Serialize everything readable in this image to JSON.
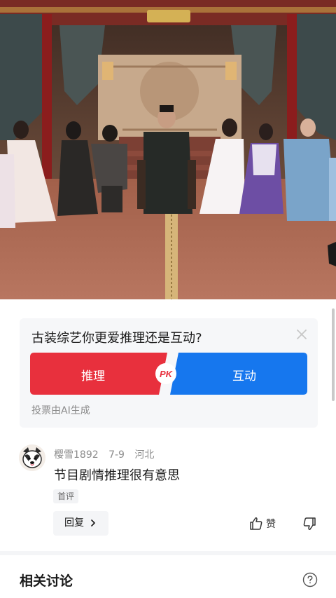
{
  "poll": {
    "question": "古装综艺你更爱推理还是互动?",
    "option_left": "推理",
    "option_right": "互动",
    "pk_badge": "PK",
    "note": "投票由AI生成",
    "colors": {
      "left": "#e8303d",
      "right": "#1677ee"
    }
  },
  "comment": {
    "username": "樱雪1892",
    "date": "7-9",
    "location": "河北",
    "text": "节目剧情推理很有意思",
    "tag": "首评",
    "reply_label": "回复",
    "like_label": "赞"
  },
  "related": {
    "title": "相关讨论"
  },
  "icons": [
    "close-icon",
    "chevron-right-icon",
    "thumbs-up-icon",
    "thumbs-down-icon",
    "help-icon"
  ]
}
